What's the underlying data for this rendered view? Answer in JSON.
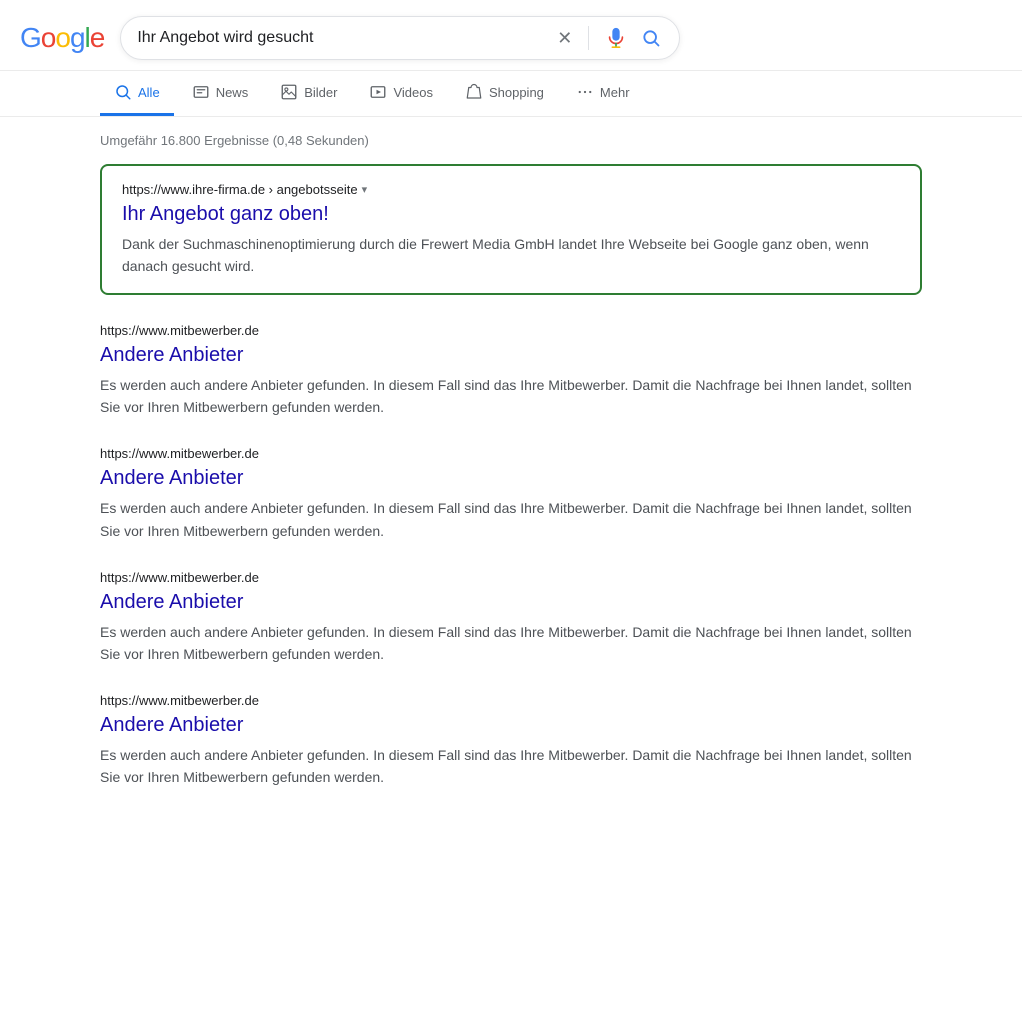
{
  "header": {
    "logo_letters": [
      {
        "letter": "G",
        "color_class": "g-blue"
      },
      {
        "letter": "o",
        "color_class": "g-red"
      },
      {
        "letter": "o",
        "color_class": "g-yellow"
      },
      {
        "letter": "g",
        "color_class": "g-blue"
      },
      {
        "letter": "l",
        "color_class": "g-green"
      },
      {
        "letter": "e",
        "color_class": "g-red"
      }
    ],
    "search_query": "Ihr Angebot wird gesucht",
    "clear_label": "×"
  },
  "nav": {
    "tabs": [
      {
        "id": "alle",
        "label": "Alle",
        "active": true,
        "icon": "search"
      },
      {
        "id": "news",
        "label": "News",
        "active": false,
        "icon": "news"
      },
      {
        "id": "bilder",
        "label": "Bilder",
        "active": false,
        "icon": "image"
      },
      {
        "id": "videos",
        "label": "Videos",
        "active": false,
        "icon": "video"
      },
      {
        "id": "shopping",
        "label": "Shopping",
        "active": false,
        "icon": "tag"
      },
      {
        "id": "mehr",
        "label": "Mehr",
        "active": false,
        "icon": "dots"
      }
    ]
  },
  "results_count": "Umgefähr 16.800 Ergebnisse (0,48 Sekunden)",
  "featured_result": {
    "url": "https://www.ihre-firma.de › angebotsseite",
    "title": "Ihr Angebot ganz oben!",
    "snippet": "Dank der Suchmaschinenoptimierung durch die Frewert Media GmbH landet Ihre Webseite bei Google ganz oben, wenn danach gesucht wird."
  },
  "results": [
    {
      "url": "https://www.mitbewerber.de",
      "title": "Andere Anbieter",
      "snippet": "Es werden auch andere Anbieter gefunden. In diesem Fall sind das Ihre Mitbewerber. Damit die Nachfrage bei Ihnen landet, sollten Sie vor Ihren Mitbewerbern gefunden werden."
    },
    {
      "url": "https://www.mitbewerber.de",
      "title": "Andere Anbieter",
      "snippet": "Es werden auch andere Anbieter gefunden. In diesem Fall sind das Ihre Mitbewerber. Damit die Nachfrage bei Ihnen landet, sollten Sie vor Ihren Mitbewerbern gefunden werden."
    },
    {
      "url": "https://www.mitbewerber.de",
      "title": "Andere Anbieter",
      "snippet": "Es werden auch andere Anbieter gefunden. In diesem Fall sind das Ihre Mitbewerber. Damit die Nachfrage bei Ihnen landet, sollten Sie vor Ihren Mitbewerbern gefunden werden."
    },
    {
      "url": "https://www.mitbewerber.de",
      "title": "Andere Anbieter",
      "snippet": "Es werden auch andere Anbieter gefunden. In diesem Fall sind das Ihre Mitbewerber. Damit die Nachfrage bei Ihnen landet, sollten Sie vor Ihren Mitbewerbern gefunden werden."
    }
  ]
}
